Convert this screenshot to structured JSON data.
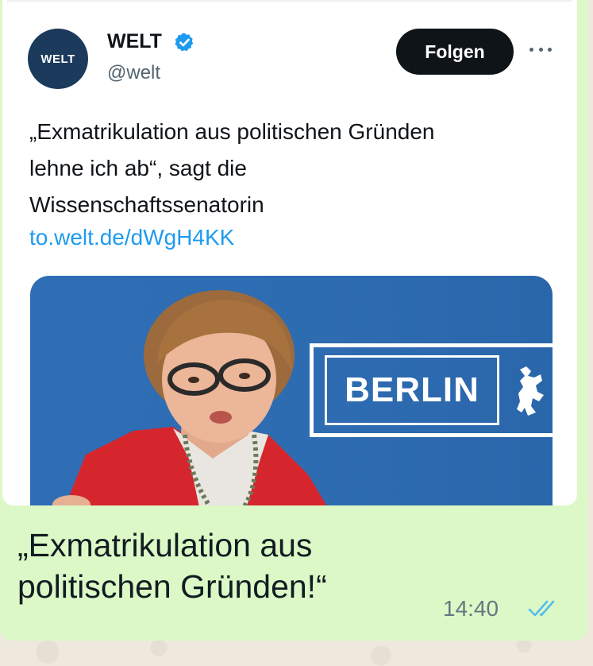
{
  "tweet": {
    "avatar_text": "WELT",
    "display_name": "WELT",
    "handle": "@welt",
    "follow_label": "Folgen",
    "text_lines": [
      "„Exmatrikulation aus politischen Gründen",
      "lehne ich ab“, sagt die",
      "Wissenschaftssenatorin"
    ],
    "link": "to.welt.de/dWgH4KK",
    "image": {
      "sign_text": "BERLIN"
    }
  },
  "message": {
    "text_lines": [
      "„Exmatrikulation aus",
      "politischen Gründen!“"
    ],
    "time": "14:40",
    "status_icon": "double-check-read-icon"
  },
  "colors": {
    "bubble": "#dcf8c6",
    "link": "#1d9bf0",
    "verified": "#1d9bf0",
    "read_ticks": "#53bdeb",
    "follow_button": "#0f1419"
  }
}
